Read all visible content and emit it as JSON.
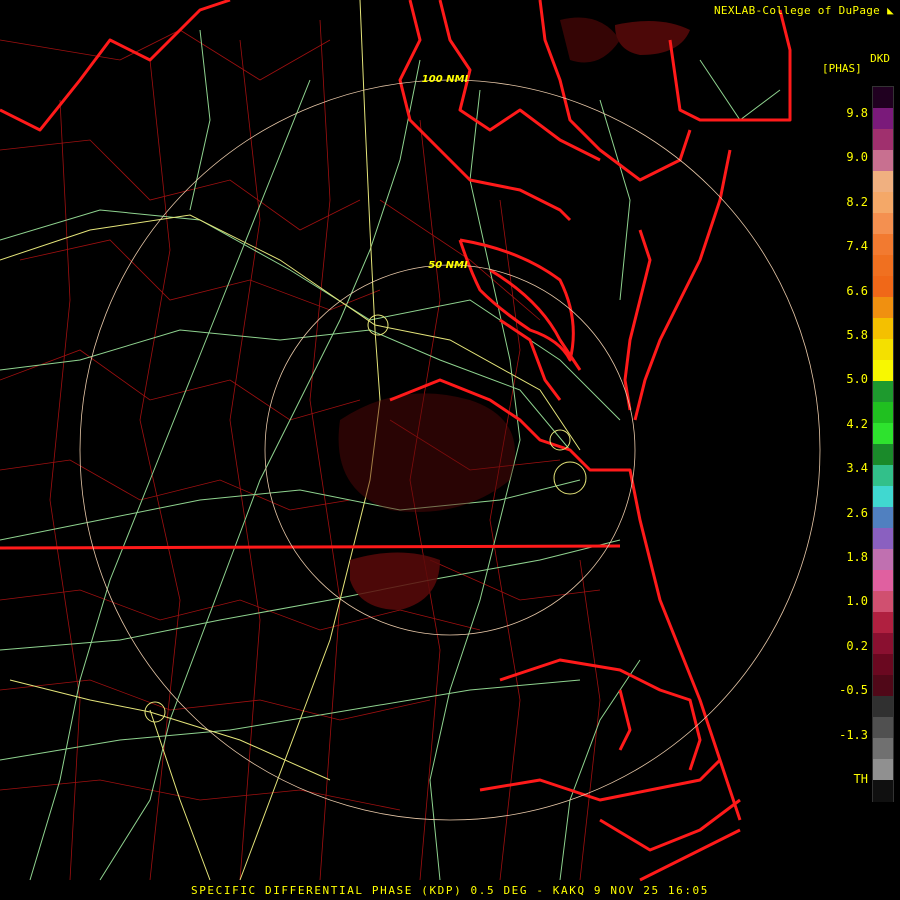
{
  "header": {
    "source": "NEXLAB-College of DuPage",
    "logo_icon": "cod-logo-icon"
  },
  "product": {
    "code": "DKD",
    "unit": "[PHAS]"
  },
  "footer": {
    "caption": "SPECIFIC DIFFERENTIAL PHASE (KDP) 0.5 DEG - KAKQ 9 NOV 25 16:05"
  },
  "rings": [
    {
      "label": "50 NMI"
    },
    {
      "label": "100 NMI"
    }
  ],
  "legend": {
    "ticks": [
      "9.8",
      "9.0",
      "8.2",
      "7.4",
      "6.6",
      "5.8",
      "5.0",
      "4.2",
      "3.4",
      "2.6",
      "1.8",
      "1.0",
      "0.2",
      "-0.5",
      "-1.3",
      "TH"
    ],
    "colors": [
      "#200020",
      "#7a1a7a",
      "#a0306e",
      "#c87090",
      "#f0b080",
      "#f4a868",
      "#f49050",
      "#f27a30",
      "#f07020",
      "#f06818",
      "#f09010",
      "#f4c000",
      "#f4e000",
      "#f8f800",
      "#1e9a2e",
      "#20c020",
      "#2ee22e",
      "#1a8a2a",
      "#32c08a",
      "#40d8d0",
      "#5080c0",
      "#8a60c0",
      "#c070b0",
      "#e060a0",
      "#d05070",
      "#b02040",
      "#8a1030",
      "#6a0820",
      "#500818",
      "#303030",
      "#505050",
      "#707070",
      "#909090",
      "#101010"
    ]
  },
  "colors": {
    "text": "#ffff00",
    "state_border": "#ff1a1a",
    "county_border": "#b01010",
    "highway": "#90d890",
    "interstate": "#e6e67a",
    "range_ring": "#e8c8a8",
    "echo": "#5a0a0a"
  }
}
